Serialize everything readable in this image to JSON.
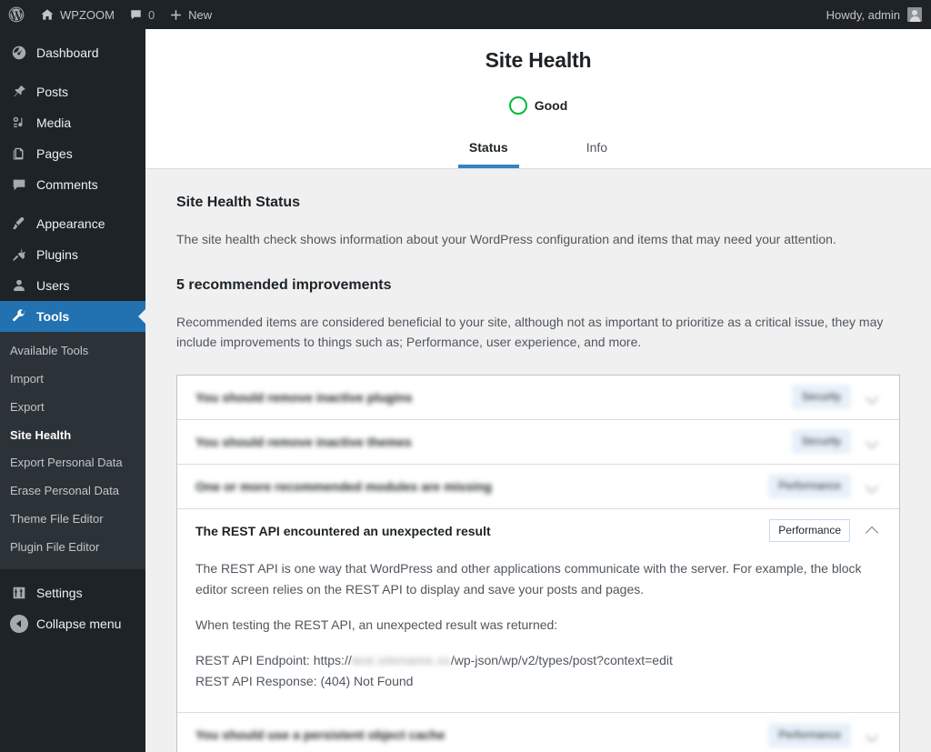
{
  "adminbar": {
    "logo_icon": "wordpress-logo-icon",
    "site_name": "WPZOOM",
    "home_icon": "home-icon",
    "comments_icon": "comment-bubble-icon",
    "comments_count": "0",
    "new_icon": "plus-icon",
    "new_label": "New",
    "howdy": "Howdy, admin",
    "avatar_icon": "avatar-icon"
  },
  "sidebar": {
    "items": [
      {
        "label": "Dashboard",
        "icon": "dashboard-icon",
        "current": false
      },
      {
        "label": "Posts",
        "icon": "pin-icon",
        "current": false
      },
      {
        "label": "Media",
        "icon": "media-icon",
        "current": false
      },
      {
        "label": "Pages",
        "icon": "pages-icon",
        "current": false
      },
      {
        "label": "Comments",
        "icon": "comment-bubble-icon",
        "current": false
      },
      {
        "label": "Appearance",
        "icon": "paintbrush-icon",
        "current": false
      },
      {
        "label": "Plugins",
        "icon": "plug-icon",
        "current": false
      },
      {
        "label": "Users",
        "icon": "user-icon",
        "current": false
      },
      {
        "label": "Tools",
        "icon": "wrench-icon",
        "current": true
      }
    ],
    "submenu": [
      {
        "label": "Available Tools",
        "current": false
      },
      {
        "label": "Import",
        "current": false
      },
      {
        "label": "Export",
        "current": false
      },
      {
        "label": "Site Health",
        "current": true
      },
      {
        "label": "Export Personal Data",
        "current": false
      },
      {
        "label": "Erase Personal Data",
        "current": false
      },
      {
        "label": "Theme File Editor",
        "current": false
      },
      {
        "label": "Plugin File Editor",
        "current": false
      }
    ],
    "settings": {
      "label": "Settings",
      "icon": "settings-sliders-icon"
    },
    "collapse": {
      "label": "Collapse menu",
      "icon": "collapse-arrow-icon"
    }
  },
  "header": {
    "title": "Site Health",
    "status_label": "Good",
    "status_icon": "green-circle-icon",
    "status_color": "#00ba37",
    "tabs": [
      {
        "label": "Status",
        "active": true
      },
      {
        "label": "Info",
        "active": false
      }
    ],
    "accent_color": "#3582c4"
  },
  "main": {
    "section_title": "Site Health Status",
    "section_desc": "The site health check shows information about your WordPress configuration and items that may need your attention.",
    "improvements_title": "5 recommended improvements",
    "improvements_desc": "Recommended items are considered beneficial to your site, although not as important to prioritize as a critical issue, they may include improvements to things such as; Performance, user experience, and more.",
    "issues": [
      {
        "title": "You should remove inactive plugins",
        "badge": "Security",
        "expanded": false,
        "blurred": true
      },
      {
        "title": "You should remove inactive themes",
        "badge": "Security",
        "expanded": false,
        "blurred": true
      },
      {
        "title": "One or more recommended modules are missing",
        "badge": "Performance",
        "expanded": false,
        "blurred": true
      },
      {
        "title": "The REST API encountered an unexpected result",
        "badge": "Performance",
        "expanded": true,
        "blurred": false,
        "body": {
          "paragraph1": "The REST API is one way that WordPress and other applications communicate with the server. For example, the block editor screen relies on the REST API to display and save your posts and pages.",
          "paragraph2": "When testing the REST API, an unexpected result was returned:",
          "endpoint_prefix": "REST API Endpoint: https://",
          "endpoint_redacted": "test.sitename.xx",
          "endpoint_suffix": "/wp-json/wp/v2/types/post?context=edit",
          "response_line": "REST API Response: (404) Not Found"
        }
      },
      {
        "title": "You should use a persistent object cache",
        "badge": "Performance",
        "expanded": false,
        "blurred": true
      }
    ]
  }
}
